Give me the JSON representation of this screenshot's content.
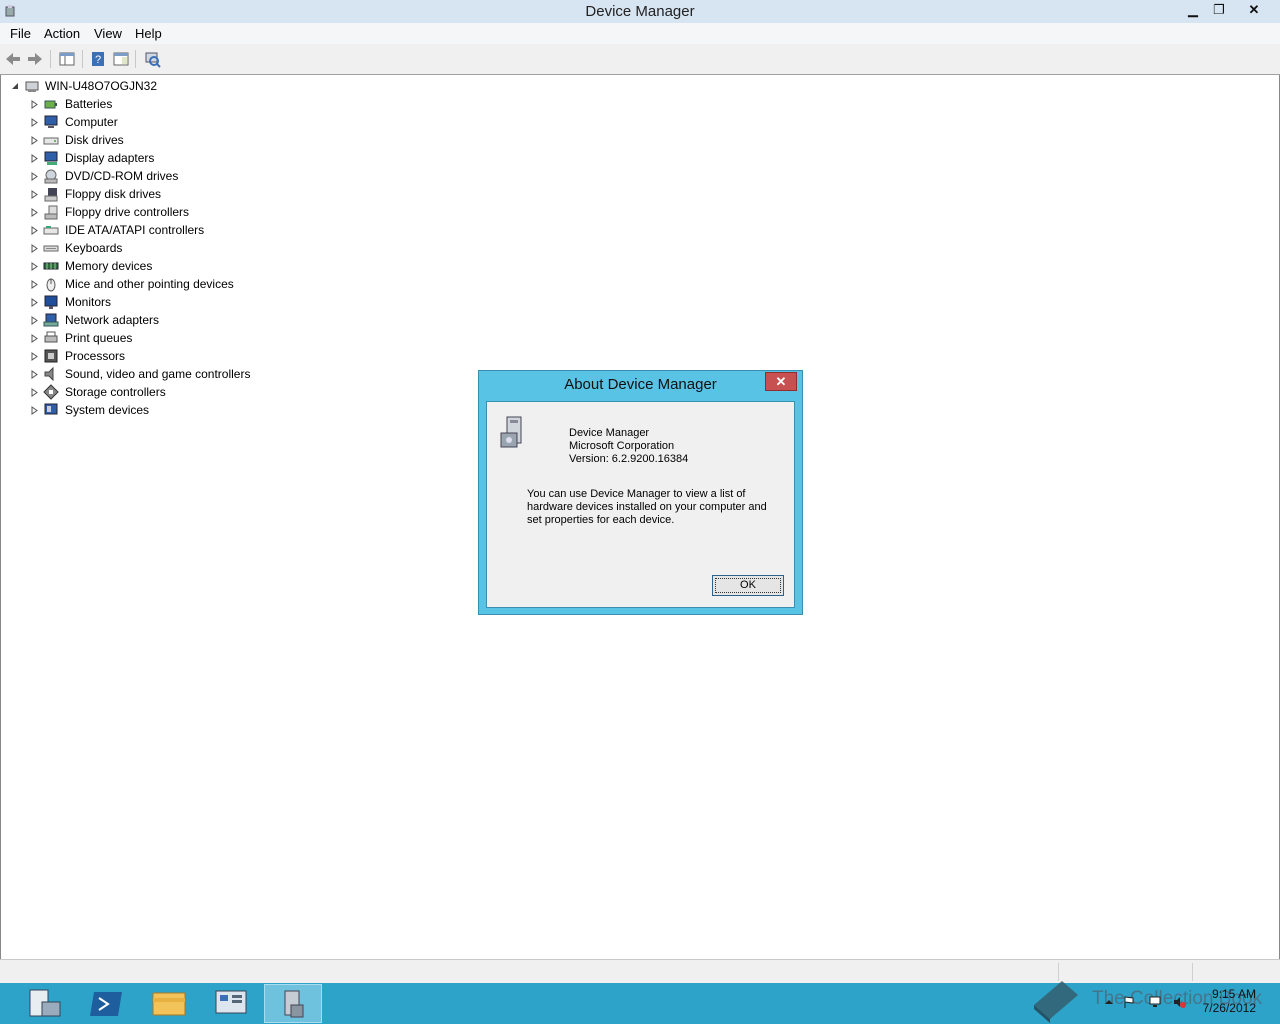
{
  "window": {
    "title": "Device Manager",
    "minimize": "▁",
    "maximize": "❐",
    "close": "✕"
  },
  "menu": [
    "File",
    "Action",
    "View",
    "Help"
  ],
  "tree": {
    "root": "WIN-U48O7OGJN32",
    "items": [
      {
        "label": "Batteries",
        "icon": "battery-icon"
      },
      {
        "label": "Computer",
        "icon": "computer-icon"
      },
      {
        "label": "Disk drives",
        "icon": "disk-drive-icon"
      },
      {
        "label": "Display adapters",
        "icon": "display-adapter-icon"
      },
      {
        "label": "DVD/CD-ROM drives",
        "icon": "dvd-drive-icon"
      },
      {
        "label": "Floppy disk drives",
        "icon": "floppy-drive-icon"
      },
      {
        "label": "Floppy drive controllers",
        "icon": "floppy-controller-icon"
      },
      {
        "label": "IDE ATA/ATAPI controllers",
        "icon": "ide-controller-icon"
      },
      {
        "label": "Keyboards",
        "icon": "keyboard-icon"
      },
      {
        "label": "Memory devices",
        "icon": "memory-icon"
      },
      {
        "label": "Mice and other pointing devices",
        "icon": "mouse-icon"
      },
      {
        "label": "Monitors",
        "icon": "monitor-icon"
      },
      {
        "label": "Network adapters",
        "icon": "network-adapter-icon"
      },
      {
        "label": "Print queues",
        "icon": "printer-icon"
      },
      {
        "label": "Processors",
        "icon": "processor-icon"
      },
      {
        "label": "Sound, video and game controllers",
        "icon": "speaker-icon"
      },
      {
        "label": "Storage controllers",
        "icon": "storage-controller-icon"
      },
      {
        "label": "System devices",
        "icon": "system-devices-icon"
      }
    ]
  },
  "dialog": {
    "title": "About Device Manager",
    "close": "✕",
    "product": "Device Manager",
    "company": "Microsoft Corporation",
    "version": "Version: 6.2.9200.16384",
    "description": "You can use Device Manager to view a list of hardware devices installed on your computer and set properties for each device.",
    "ok": "OK"
  },
  "taskbar": {
    "apps": [
      "server-manager-icon",
      "powershell-icon",
      "file-explorer-icon",
      "control-panel-icon",
      "device-manager-icon"
    ],
    "time": "9:15 AM",
    "date": "7/26/2012",
    "watermark": "The Collection Book"
  },
  "colors": {
    "taskbar": "#2ea3c9",
    "dialog_frame": "#59c3e6",
    "close_red": "#c75050"
  }
}
